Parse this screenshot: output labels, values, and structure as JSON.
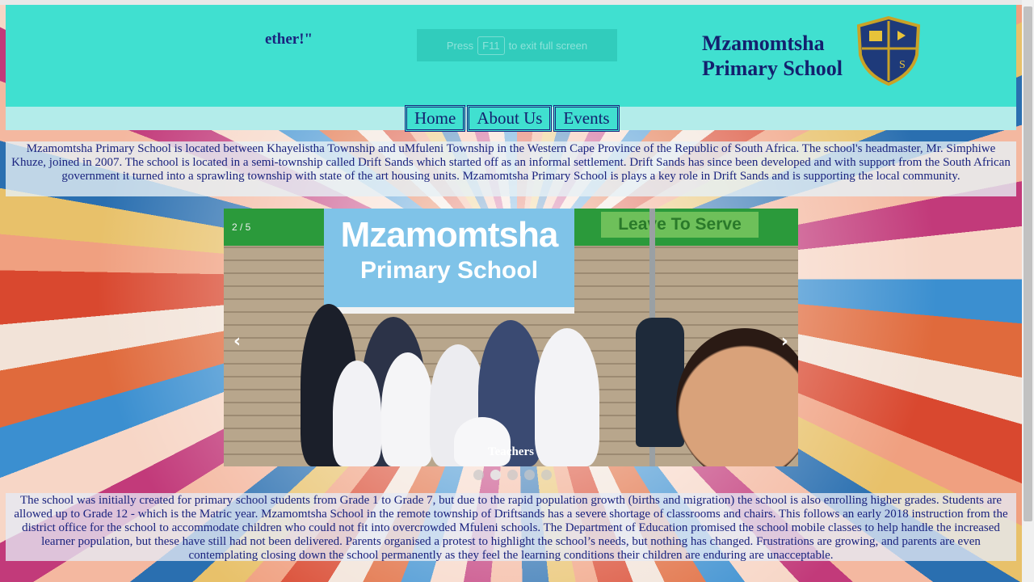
{
  "header": {
    "ticker_text": "ether!\"",
    "school_name_line1": "Mzamomtsha",
    "school_name_line2": "Primary School",
    "crest_icon": "school-crest-icon"
  },
  "fullscreen_notice": {
    "prefix": "Press",
    "key": "F11",
    "suffix": "to exit full screen"
  },
  "nav": {
    "items": [
      {
        "label": "Home"
      },
      {
        "label": "About Us"
      },
      {
        "label": "Events"
      }
    ]
  },
  "intro": {
    "text": "Mzamomtsha Primary School is located between Khayelistha Township and uMfuleni Township in the Western Cape Province of the Republic of South Africa. The school's headmaster, Mr. Simphiwe Khuze, joined in 2007. The school is located in a semi-township called Drift Sands which started off as an informal settlement. Drift Sands has since been developed and with support from the South African government it turned into a sprawling township with state of the art housing units. Mzamomtsha Primary School is plays a key role in Drift Sands and is supporting the local community."
  },
  "slideshow": {
    "counter": "2 / 5",
    "sign_line1": "Mzamomtsha",
    "sign_line2": "Primary School",
    "banner_text": "Leave To Serve",
    "caption": "Teachers",
    "prev_glyph": "‹",
    "next_glyph": "›",
    "total_slides": 5,
    "active_slide": 2
  },
  "history": {
    "text": "The school was initially created for primary school students from Grade 1 to Grade 7, but due to the rapid population growth (births and migration) the school is also enrolling higher grades. Students are allowed up to Grade 12 - which is the Matric year. Mzamomtsha School in the remote township of Driftsands has a severe shortage of classrooms and chairs. This follows an early 2018 instruction from the district office for the school to accommodate children who could not fit into overcrowded Mfuleni schools. The Department of Education promised the school mobile classes to help handle the increased learner population, but these have still had not been delivered. Parents organised a protest to highlight the school’s needs, but nothing has changed. Frustrations are growing, and parents are even contemplating closing down the school permanently as they feel the learning conditions their children are enduring are unacceptable."
  },
  "colors": {
    "header_bg": "#40e0d0",
    "text_navy": "#1a237e"
  }
}
